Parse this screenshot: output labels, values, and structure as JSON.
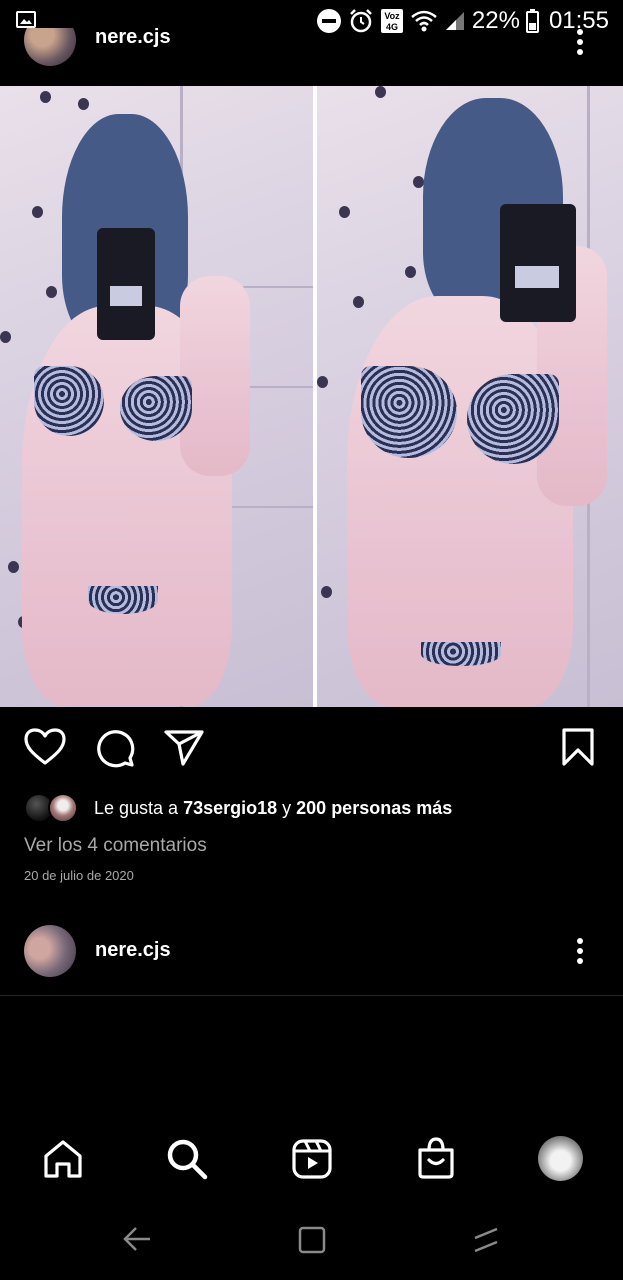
{
  "status_bar": {
    "battery": "22%",
    "time": "01:55",
    "network_label": "Voz 4G"
  },
  "post": {
    "username": "nere.cjs",
    "likes": {
      "prefix": "Le gusta a ",
      "user": "73sergio18",
      "middle": " y ",
      "others": "200 personas más"
    },
    "comments_link": "Ver los 4 comentarios",
    "date": "20 de julio de 2020"
  },
  "next_post": {
    "username": "nere.cjs"
  },
  "icons": {
    "status": [
      "gallery-icon",
      "do-not-disturb-icon",
      "alarm-icon",
      "volte-icon",
      "wifi-icon",
      "signal-icon",
      "battery-icon"
    ],
    "actions": [
      "heart-icon",
      "comment-icon",
      "share-icon",
      "bookmark-icon"
    ],
    "nav": [
      "home-icon",
      "search-icon",
      "reels-icon",
      "shop-icon"
    ],
    "system": [
      "back-icon",
      "recents-icon",
      "recent-apps-icon"
    ]
  }
}
